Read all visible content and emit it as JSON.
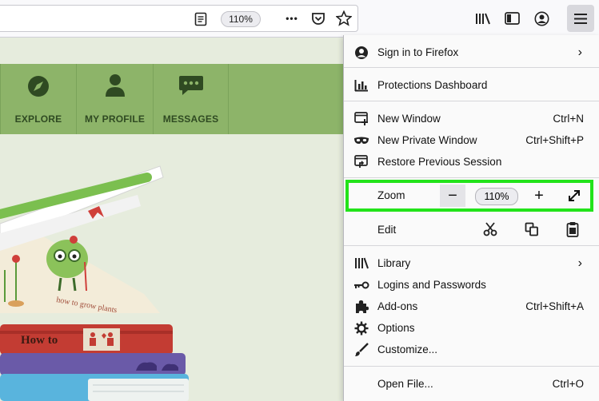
{
  "toolbar": {
    "zoom_level": "110%",
    "more_glyph": "•••",
    "icons": [
      "reader-view-icon",
      "more-actions-icon",
      "pocket-icon",
      "bookmark-star-icon",
      "library-icon",
      "sidebar-icon",
      "account-icon",
      "hamburger-menu-icon"
    ]
  },
  "site": {
    "nav": [
      {
        "label": "EXPLORE",
        "icon": "compass-icon"
      },
      {
        "label": "MY PROFILE",
        "icon": "person-icon"
      },
      {
        "label": "MESSAGES",
        "icon": "chat-bubble-icon"
      }
    ],
    "book_title": "How to",
    "page_text": "how to grow plants",
    "colors": {
      "nav_bg": "#8db469",
      "page_bg": "#e6ecdd"
    }
  },
  "menu": {
    "sign_in": "Sign in to Firefox",
    "protections": "Protections Dashboard",
    "new_window": {
      "label": "New Window",
      "shortcut": "Ctrl+N"
    },
    "new_private": {
      "label": "New Private Window",
      "shortcut": "Ctrl+Shift+P"
    },
    "restore": "Restore Previous Session",
    "zoom": {
      "label": "Zoom",
      "minus": "−",
      "value": "110%",
      "plus": "+",
      "fullscreen": "⤢"
    },
    "edit": "Edit",
    "library": "Library",
    "logins": "Logins and Passwords",
    "addons": {
      "label": "Add-ons",
      "shortcut": "Ctrl+Shift+A"
    },
    "options": "Options",
    "customize": "Customize...",
    "open_file": {
      "label": "Open File...",
      "shortcut": "Ctrl+O"
    },
    "highlight_color": "#22e31a"
  }
}
